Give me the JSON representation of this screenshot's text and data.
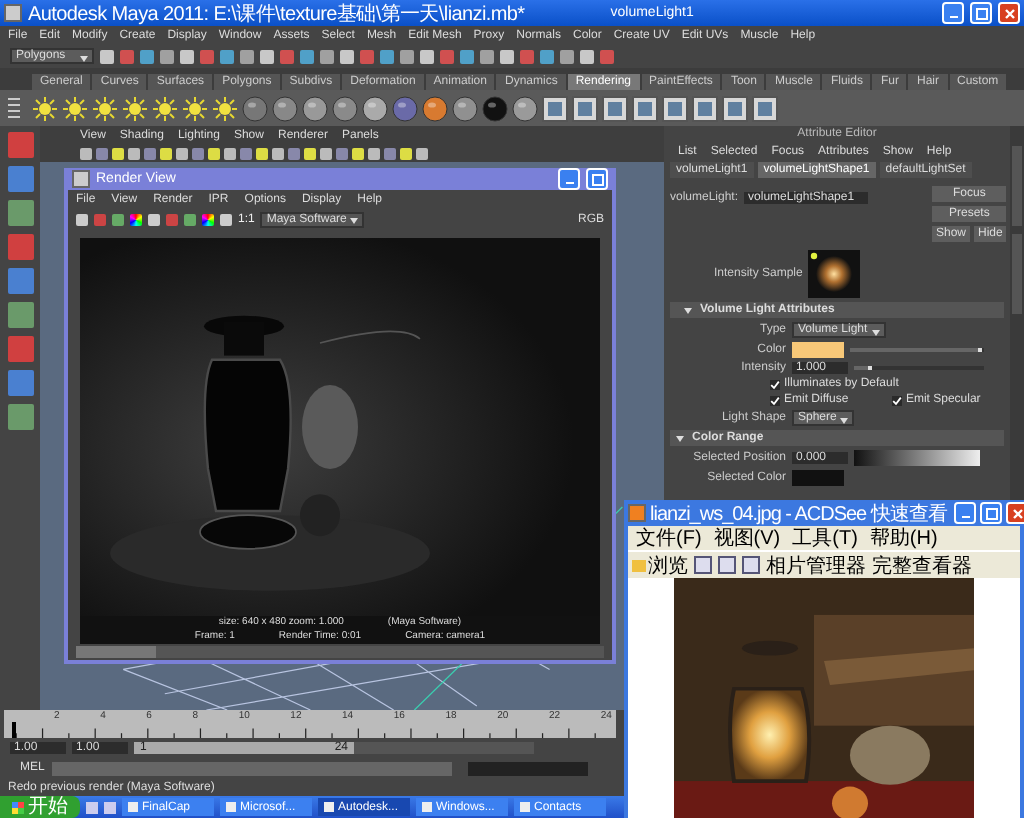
{
  "title_bar": {
    "title": "Autodesk Maya 2011: E:\\课件\\texture基础\\第一天\\lianzi.mb*",
    "object": "volumeLight1"
  },
  "menu_bar": [
    "File",
    "Edit",
    "Modify",
    "Create",
    "Display",
    "Window",
    "Assets",
    "Select",
    "Mesh",
    "Edit Mesh",
    "Proxy",
    "Normals",
    "Color",
    "Create UV",
    "Edit UVs",
    "Muscle",
    "Help"
  ],
  "status_line": {
    "menu_set": "Polygons"
  },
  "shelf_tabs": [
    {
      "label": "General",
      "selected": false
    },
    {
      "label": "Curves",
      "selected": false
    },
    {
      "label": "Surfaces",
      "selected": false
    },
    {
      "label": "Polygons",
      "selected": false
    },
    {
      "label": "Subdivs",
      "selected": false
    },
    {
      "label": "Deformation",
      "selected": false
    },
    {
      "label": "Animation",
      "selected": false
    },
    {
      "label": "Dynamics",
      "selected": false
    },
    {
      "label": "Rendering",
      "selected": true
    },
    {
      "label": "PaintEffects",
      "selected": false
    },
    {
      "label": "Toon",
      "selected": false
    },
    {
      "label": "Muscle",
      "selected": false
    },
    {
      "label": "Fluids",
      "selected": false
    },
    {
      "label": "Fur",
      "selected": false
    },
    {
      "label": "Hair",
      "selected": false
    },
    {
      "label": "Custom",
      "selected": false
    }
  ],
  "viewport": {
    "menu": [
      "View",
      "Shading",
      "Lighting",
      "Show",
      "Renderer",
      "Panels"
    ]
  },
  "render_view": {
    "title": "Render View",
    "menu": [
      "File",
      "View",
      "Render",
      "IPR",
      "Options",
      "Display",
      "Help"
    ],
    "one_to_one": "1:1",
    "renderer": "Maya Software",
    "channels": "RGB",
    "info": [
      "size: 640 x 480  zoom: 1.000",
      "(Maya Software)",
      "Frame: 1",
      "Render Time: 0:01",
      "Camera: camera1"
    ]
  },
  "attribute_editor": {
    "title": "Attribute Editor",
    "menu": [
      "List",
      "Selected",
      "Focus",
      "Attributes",
      "Show",
      "Help"
    ],
    "tabs": [
      {
        "label": "volumeLight1",
        "selected": false
      },
      {
        "label": "volumeLightShape1",
        "selected": true
      },
      {
        "label": "defaultLightSet",
        "selected": false
      }
    ],
    "node_label": "volumeLight:",
    "node_value": "volumeLightShape1",
    "buttons": [
      "Focus",
      "Presets",
      "Show",
      "Hide"
    ],
    "sample_label": "Intensity Sample",
    "volume_section": {
      "title": "Volume Light Attributes",
      "expanded": true
    },
    "type_label": "Type",
    "type_value": "Volume Light",
    "color_label": "Color",
    "color_slider": {
      "level": 0.95
    },
    "intensity_label": "Intensity",
    "intensity_value": "1.000",
    "intensity_slider": {
      "level": 0.1
    },
    "checkboxes": [
      {
        "label": "Illuminates by Default",
        "checked": true
      },
      {
        "label": "Emit Diffuse",
        "checked": true
      },
      {
        "label": "Emit Specular",
        "checked": true
      }
    ],
    "shape_label": "Light Shape",
    "shape_value": "Sphere",
    "range_section": {
      "title": "Color Range",
      "expanded": true
    },
    "position_label": "Selected Position",
    "position_value": "0.000",
    "selected_color_label": "Selected Color"
  },
  "acdsee": {
    "title": "lianzi_ws_04.jpg - ACDSee 快速查看",
    "menu": [
      "文件(F)",
      "视图(V)",
      "工具(T)",
      "帮助(H)"
    ],
    "toolbar": [
      "浏览",
      "相片管理器",
      "完整查看器"
    ]
  },
  "time_slider": {
    "level": 0,
    "ticks": [
      "2",
      "4",
      "6",
      "8",
      "10",
      "12",
      "14",
      "16",
      "18",
      "20",
      "22",
      "24"
    ]
  },
  "range_slider": {
    "start": "1.00",
    "range_start": "1.00",
    "playback_start": "1",
    "playback_end": "24",
    "level": 0.55
  },
  "command_line": {
    "label": "MEL"
  },
  "help_line": "Redo previous render (Maya Software)",
  "taskbar": {
    "start": "开始",
    "items": [
      "FinalCap",
      "Microsof...",
      "Autodesk...",
      "Windows...",
      "Contacts"
    ]
  }
}
